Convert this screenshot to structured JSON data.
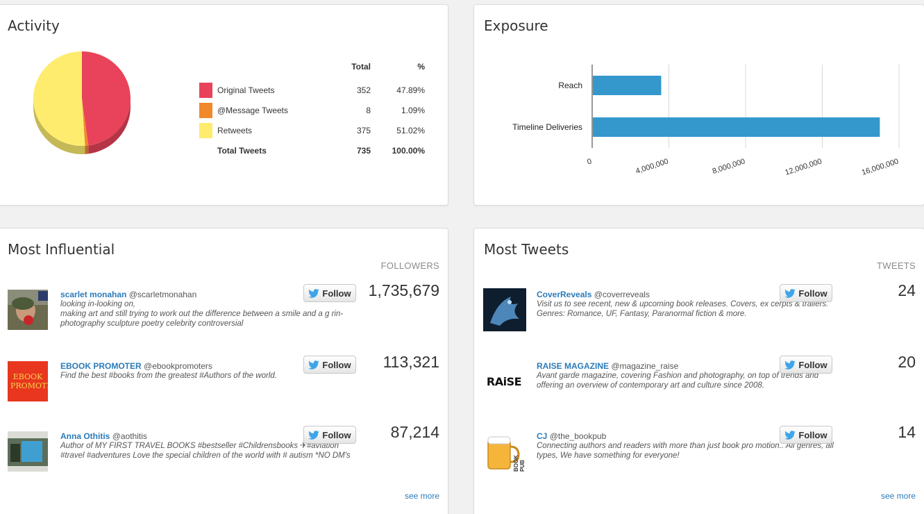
{
  "activity": {
    "title": "Activity",
    "col_total": "Total",
    "col_pct": "%",
    "rows": [
      {
        "label": "Original Tweets",
        "total": "352",
        "pct": "47.89%",
        "color": "#e8435a"
      },
      {
        "label": "@Message Tweets",
        "total": "8",
        "pct": "1.09%",
        "color": "#f0882c"
      },
      {
        "label": "Retweets",
        "total": "375",
        "pct": "51.02%",
        "color": "#fdec6e"
      }
    ],
    "sum": {
      "label": "Total Tweets",
      "total": "735",
      "pct": "100.00%"
    }
  },
  "exposure": {
    "title": "Exposure"
  },
  "chart_data": [
    {
      "type": "pie",
      "labels": [
        "Original Tweets",
        "@Message Tweets",
        "Retweets"
      ],
      "values": [
        47.89,
        1.09,
        51.02
      ],
      "colors": [
        "#e8435a",
        "#f0882c",
        "#fdec6e"
      ]
    },
    {
      "type": "bar",
      "orientation": "horizontal",
      "categories": [
        "Reach",
        "Timeline Deliveries"
      ],
      "values": [
        3600000,
        15000000
      ],
      "xlim": [
        0,
        16000000
      ],
      "ticks": [
        "0",
        "4,000,000",
        "8,000,000",
        "12,000,000",
        "16,000,000"
      ],
      "color": "#3498cc",
      "grid": true
    }
  ],
  "influential": {
    "title": "Most Influential",
    "col_head": "FOLLOWERS",
    "follow_label": "Follow",
    "see_more": "see more",
    "users": [
      {
        "name": "scarlet monahan",
        "handle": "@scarletmonahan",
        "bio": "looking in-looking on,\nmaking art and still trying to work out the difference between a smile and a g rin-\nphotography sculpture poetry celebrity controversial",
        "count": "1,735,679"
      },
      {
        "name": "EBOOK PROMOTER",
        "handle": "@ebookpromoters",
        "bio": "Find the best #books from the greatest #Authors of the world.",
        "count": "113,321",
        "avatar_text": "EBOOK PROMOTER"
      },
      {
        "name": "Anna Othitis",
        "handle": "@aothitis",
        "bio": "Author of MY FIRST TRAVEL BOOKS #bestseller #Childrensbooks ✈#aviation #travel #adventures Love the special children of the world with # autism  *NO DM's",
        "count": "87,214"
      }
    ]
  },
  "tweets": {
    "title": "Most Tweets",
    "col_head": "TWEETS",
    "follow_label": "Follow",
    "see_more": "see more",
    "users": [
      {
        "name": "CoverReveals",
        "handle": "@coverreveals",
        "bio": "Visit us to see recent, new & upcoming book releases. Covers, ex cerpts & trailers. Genres: Romance, UF, Fantasy, Paranormal fiction & more.",
        "count": "24"
      },
      {
        "name": "RAISE MAGAZINE",
        "handle": "@magazine_raise",
        "bio": "Avant garde magazine, covering Fashion and photography, on top of trends and offering an overview of contemporary art and culture since 2008.",
        "count": "20",
        "avatar_text": "RAiSE"
      },
      {
        "name": "CJ",
        "handle": "@the_bookpub",
        "bio": "Connecting authors and readers with more than just book pro motion.. All genres, all types, We have something for everyone!",
        "count": "14",
        "avatar_text": "BOOK PUB"
      }
    ]
  }
}
